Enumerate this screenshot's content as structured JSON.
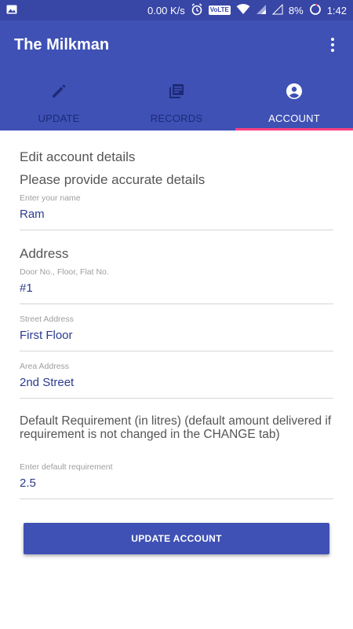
{
  "status_bar": {
    "net_speed": "0.00 K/s",
    "volte": "VoLTE",
    "battery": "8%",
    "time": "1:42",
    "icons": [
      "image-icon",
      "alarm-icon",
      "wifi-icon",
      "signal-icon",
      "signal-icon",
      "battery-icon"
    ]
  },
  "app_bar": {
    "title": "The Milkman",
    "menu_icon": "more-vert-icon"
  },
  "tabs": [
    {
      "label": "UPDATE",
      "icon": "pencil-icon",
      "active": false
    },
    {
      "label": "RECORDS",
      "icon": "records-icon",
      "active": false
    },
    {
      "label": "ACCOUNT",
      "icon": "account-icon",
      "active": true
    }
  ],
  "form": {
    "heading": "Edit account details",
    "subheading": "Please provide accurate details",
    "name": {
      "label": "Enter your name",
      "value": "Ram"
    },
    "address_heading": "Address",
    "door": {
      "label": "Door No., Floor, Flat No.",
      "value": "#1"
    },
    "street": {
      "label": "Street Address",
      "value": "First Floor"
    },
    "area": {
      "label": "Area Address",
      "value": "2nd Street"
    },
    "requirement_heading": "Default Requirement (in litres) (default amount delivered if requirement is not changed in the CHANGE tab)",
    "requirement": {
      "label": "Enter default requirement",
      "value": "2.5"
    },
    "submit_label": "UPDATE ACCOUNT"
  },
  "colors": {
    "primary": "#3f51b5",
    "primary_dark": "#3846a6",
    "accent": "#ff4081",
    "tab_inactive": "#1e2a78",
    "value_text": "#2b3a8f"
  }
}
